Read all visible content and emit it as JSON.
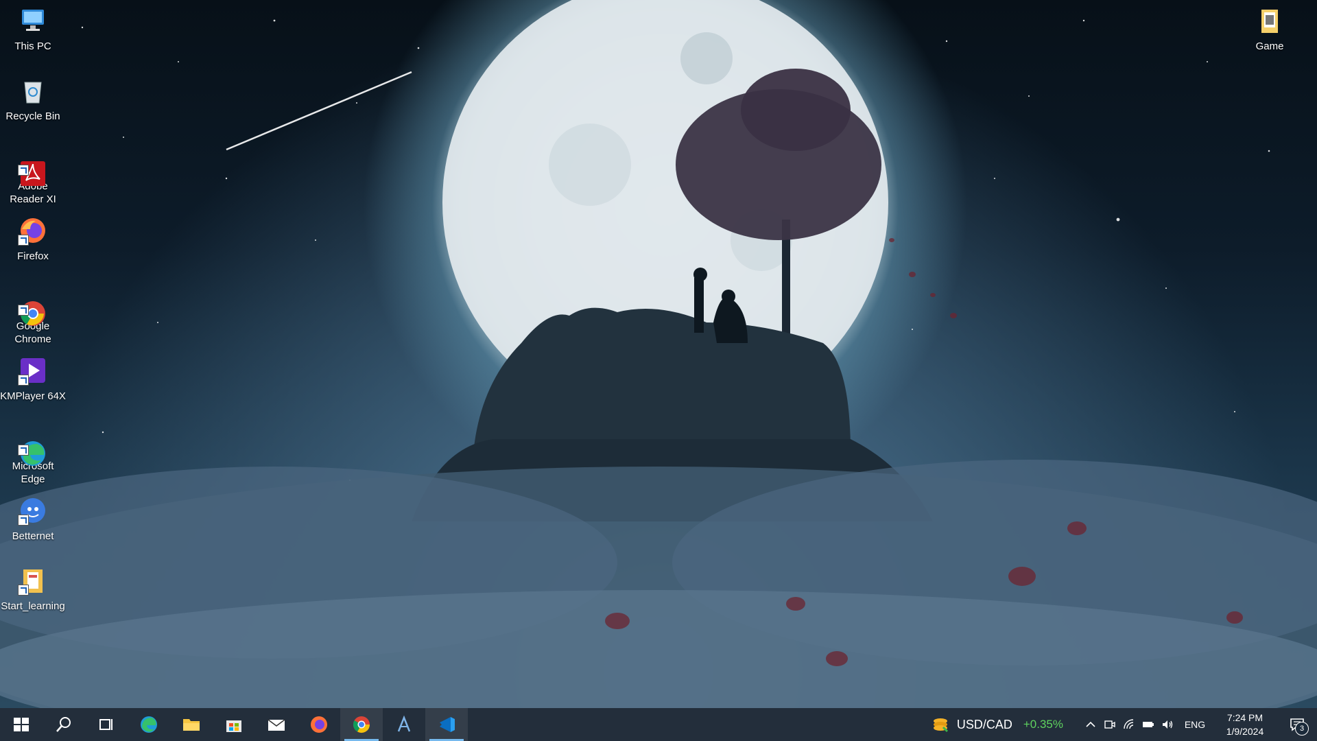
{
  "desktop": {
    "icons_left": [
      {
        "name": "this-pc",
        "label": "This PC"
      },
      {
        "name": "recycle-bin",
        "label": "Recycle Bin"
      },
      {
        "name": "adobe-reader",
        "label": "Adobe\nReader XI"
      },
      {
        "name": "firefox",
        "label": "Firefox"
      },
      {
        "name": "google-chrome",
        "label": "Google\nChrome"
      },
      {
        "name": "kmplayer",
        "label": "KMPlayer 64X"
      },
      {
        "name": "microsoft-edge",
        "label": "Microsoft\nEdge"
      },
      {
        "name": "betternet",
        "label": "Betternet"
      },
      {
        "name": "start-learning",
        "label": "Start_learning"
      }
    ],
    "icon_right": {
      "name": "game",
      "label": "Game"
    }
  },
  "taskbar": {
    "pinned": [
      {
        "name": "start",
        "icon": "windows-logo-icon"
      },
      {
        "name": "search",
        "icon": "search-icon"
      },
      {
        "name": "task-view",
        "icon": "task-view-icon"
      },
      {
        "name": "edge",
        "icon": "edge-icon"
      },
      {
        "name": "file-explorer",
        "icon": "folder-icon"
      },
      {
        "name": "microsoft-store",
        "icon": "store-icon"
      },
      {
        "name": "mail",
        "icon": "mail-icon"
      },
      {
        "name": "firefox",
        "icon": "firefox-icon"
      },
      {
        "name": "chrome",
        "icon": "chrome-icon",
        "active": true
      },
      {
        "name": "app-a",
        "icon": "a-app-icon"
      },
      {
        "name": "vscode",
        "icon": "vscode-icon",
        "active": true
      }
    ],
    "widget": {
      "label": "USD/CAD",
      "change": "+0.35%",
      "change_color": "#5fd35f"
    },
    "language": "ENG",
    "time": "7:24 PM",
    "date": "1/9/2024",
    "notification_count": "3"
  },
  "colors": {
    "taskbar": "#121e2c",
    "accent": "#76b9ed"
  }
}
